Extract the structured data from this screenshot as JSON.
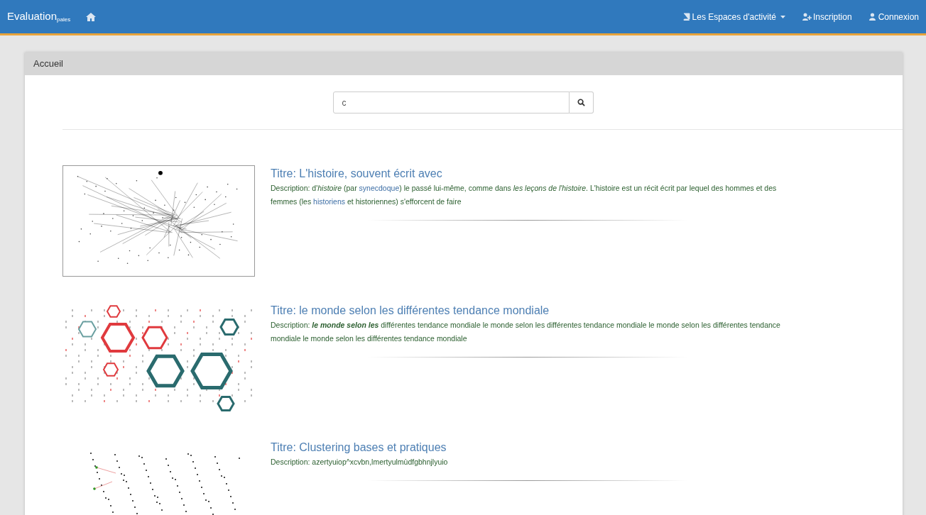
{
  "navbar": {
    "brand": "Evaluation",
    "brand_suffix": "pales",
    "menu": [
      {
        "kind": "dropdown",
        "label": "Les Espaces d'activité"
      },
      {
        "kind": "signup",
        "label": "Inscription"
      },
      {
        "kind": "login",
        "label": "Connexion"
      }
    ]
  },
  "panel": {
    "title": "Accueil"
  },
  "search": {
    "value": "c"
  },
  "results": [
    {
      "kind": "network",
      "title": "Titre: L'histoire, souvent écrit avec",
      "description_label": "Description:",
      "description": [
        {
          "kind": "plain",
          "text": " d'"
        },
        {
          "kind": "italic",
          "text": "histoire"
        },
        {
          "kind": "plain",
          "text": " (par "
        },
        {
          "kind": "link",
          "text": "synecdoque"
        },
        {
          "kind": "plain",
          "text": ") le passé lui-même, comme dans "
        },
        {
          "kind": "italic",
          "text": "les leçons de l'histoire"
        },
        {
          "kind": "plain",
          "text": ". L'histoire est un récit écrit par lequel des hommes et des femmes (les "
        },
        {
          "kind": "link",
          "text": "historiens"
        },
        {
          "kind": "plain",
          "text": " et historiennes) s'efforcent de faire"
        }
      ]
    },
    {
      "kind": "hexagons",
      "title": "Titre: le monde selon les différentes tendance mondiale",
      "description_label": "Description:",
      "description": [
        {
          "kind": "bold_italic",
          "text": "le monde selon les"
        },
        {
          "kind": "plain",
          "text": " différentes tendance mondiale le monde selon les différentes tendance mondiale le monde selon les différentes tendance mondiale le monde selon les différentes tendance mondiale"
        }
      ]
    },
    {
      "kind": "scatter",
      "title": "Titre: Clustering bases et pratiques",
      "description_label": "Description:",
      "description": [
        {
          "kind": "plain",
          "text": "azertyuiop^xcvbn,lmertyulmùdfgbhnjlyuio"
        }
      ]
    }
  ]
}
